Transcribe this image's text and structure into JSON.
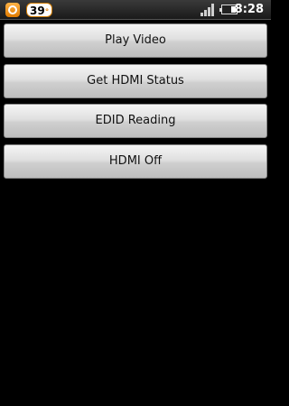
{
  "status_bar": {
    "temperature": "39",
    "temperature_unit": "°",
    "time": "8:28",
    "battery_level": 0.35,
    "icons": [
      "notification-icon",
      "signal-icon",
      "battery-icon"
    ]
  },
  "buttons": [
    {
      "label": "Play Video"
    },
    {
      "label": "Get HDMI Status"
    },
    {
      "label": "EDID Reading"
    },
    {
      "label": "HDMI Off"
    }
  ],
  "colors": {
    "background": "#000000",
    "accent": "#e07b00"
  }
}
